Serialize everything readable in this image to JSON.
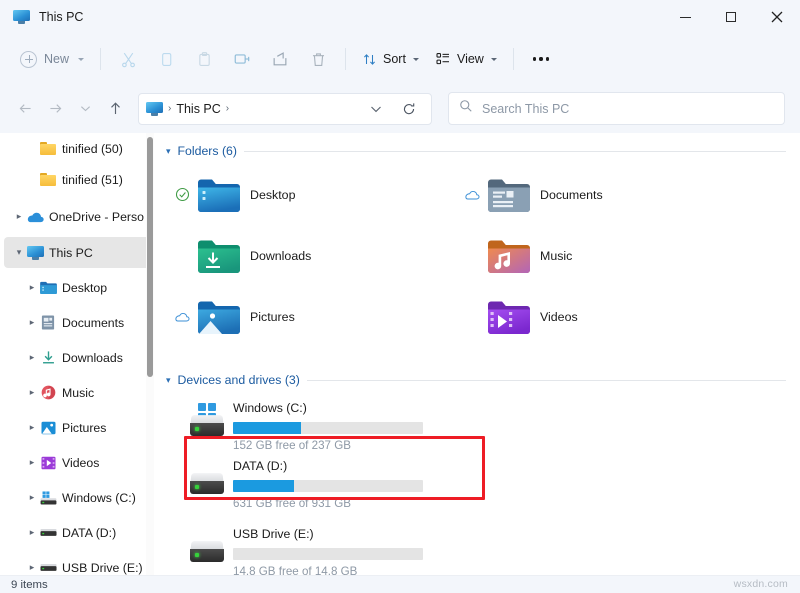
{
  "window": {
    "title": "This PC",
    "title_icon": "monitor-icon",
    "controls": {
      "minimize": "minimize-icon",
      "maximize": "maximize-icon",
      "close": "close-icon"
    }
  },
  "toolbar": {
    "new_label": "New",
    "new_caret": "chevron-down-icon",
    "actions": [
      {
        "name": "cut-icon",
        "label": "Cut",
        "enabled": false
      },
      {
        "name": "copy-icon",
        "label": "Copy",
        "enabled": false
      },
      {
        "name": "paste-icon",
        "label": "Paste",
        "enabled": false
      },
      {
        "name": "rename-icon",
        "label": "Rename",
        "enabled": false
      },
      {
        "name": "share-icon",
        "label": "Share",
        "enabled": false
      },
      {
        "name": "delete-icon",
        "label": "Delete",
        "enabled": false
      }
    ],
    "sort_label": "Sort",
    "view_label": "View",
    "more_label": "See more"
  },
  "navigation": {
    "back": "back-arrow-icon",
    "forward": "forward-arrow-icon",
    "recent": "chevron-down-icon",
    "up": "up-arrow-icon",
    "breadcrumb": {
      "icon": "monitor-icon",
      "path": "This PC",
      "sep": "›"
    },
    "history_caret": "chevron-down-icon",
    "refresh": "refresh-icon"
  },
  "search": {
    "icon": "search-icon",
    "placeholder": "Search This PC",
    "value": ""
  },
  "sidebar": {
    "items": [
      {
        "label": "tinified (50)",
        "icon": "folder-icon",
        "chevron": false,
        "indent": true,
        "selected": false
      },
      {
        "label": "tinified (51)",
        "icon": "folder-icon",
        "chevron": false,
        "indent": true,
        "selected": false
      },
      {
        "label": "OneDrive - Perso",
        "icon": "onedrive-cloud-icon",
        "chevron": true,
        "indent": false,
        "selected": false
      },
      {
        "label": "This PC",
        "icon": "monitor-icon",
        "chevron": true,
        "expanded": true,
        "indent": false,
        "selected": true
      },
      {
        "label": "Desktop",
        "icon": "desktop-folder-icon",
        "chevron": true,
        "indent": true,
        "selected": false
      },
      {
        "label": "Documents",
        "icon": "documents-folder-icon",
        "chevron": true,
        "indent": true,
        "selected": false
      },
      {
        "label": "Downloads",
        "icon": "downloads-icon",
        "chevron": true,
        "indent": true,
        "selected": false
      },
      {
        "label": "Music",
        "icon": "music-folder-icon",
        "chevron": true,
        "indent": true,
        "selected": false
      },
      {
        "label": "Pictures",
        "icon": "pictures-folder-icon",
        "chevron": true,
        "indent": true,
        "selected": false
      },
      {
        "label": "Videos",
        "icon": "videos-folder-icon",
        "chevron": true,
        "indent": true,
        "selected": false
      },
      {
        "label": "Windows (C:)",
        "icon": "windows-drive-icon",
        "chevron": true,
        "indent": true,
        "selected": false
      },
      {
        "label": "DATA (D:)",
        "icon": "drive-icon",
        "chevron": true,
        "indent": true,
        "selected": false
      },
      {
        "label": "USB Drive (E:)",
        "icon": "drive-icon",
        "chevron": true,
        "indent": true,
        "selected": false
      }
    ]
  },
  "main": {
    "folders_group": {
      "title": "Folders (6)",
      "chevron": "chevron-down-icon",
      "items": [
        {
          "name": "Desktop",
          "icon": "desktop-folder-icon",
          "status": "synced-check-icon"
        },
        {
          "name": "Documents",
          "icon": "documents-folder-icon",
          "status": "cloud-only-icon"
        },
        {
          "name": "Downloads",
          "icon": "downloads-folder-icon",
          "status": ""
        },
        {
          "name": "Music",
          "icon": "music-folder-icon",
          "status": ""
        },
        {
          "name": "Pictures",
          "icon": "pictures-folder-icon",
          "status": "cloud-only-icon"
        },
        {
          "name": "Videos",
          "icon": "videos-folder-icon",
          "status": ""
        }
      ]
    },
    "drives_group": {
      "title": "Devices and drives (3)",
      "chevron": "chevron-down-icon",
      "items": [
        {
          "name": "Windows (C:)",
          "icon": "windows-drive-icon",
          "free_text": "152 GB free of 237 GB",
          "free_gb": 152,
          "total_gb": 237,
          "used_percent": 36,
          "bar_color": "#1b9ae0",
          "highlighted": false
        },
        {
          "name": "DATA (D:)",
          "icon": "drive-icon",
          "free_text": "631 GB free of 931 GB",
          "free_gb": 631,
          "total_gb": 931,
          "used_percent": 32,
          "bar_color": "#1b9ae0",
          "highlighted": false
        },
        {
          "name": "USB Drive (E:)",
          "icon": "drive-icon",
          "free_text": "14.8 GB free of 14.8 GB",
          "free_gb": 14.8,
          "total_gb": 14.8,
          "used_percent": 0,
          "bar_color": "#1b9ae0",
          "highlighted": true
        }
      ]
    }
  },
  "highlight": {
    "color": "#ee1c25",
    "target": "USB Drive (E:)"
  },
  "statusbar": {
    "item_count": "9 items"
  },
  "watermark": {
    "text": "wsxdn.com"
  },
  "colors": {
    "accent": "#1b9ae0",
    "group_header": "#1c5ba0",
    "chrome_bg": "#f3f6fb",
    "selection": "#e6e6e6",
    "highlight_red": "#ee1c25"
  }
}
